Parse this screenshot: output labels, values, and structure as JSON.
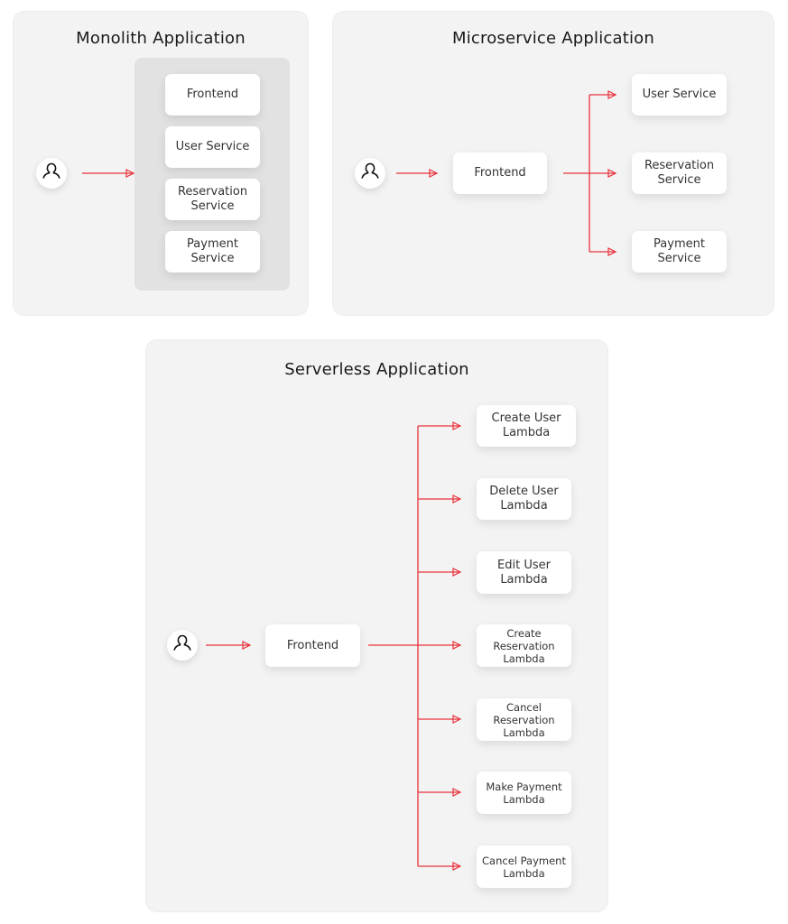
{
  "colors": {
    "arrow": "#e8323c",
    "panel_bg": "#f3f3f3",
    "inner_bg": "#e2e2e2",
    "node_bg": "#ffffff"
  },
  "monolith": {
    "title": "Monolith Application",
    "user_icon": "user-icon",
    "components": [
      "Frontend",
      "User Service",
      "Reservation\nService",
      "Payment\nService"
    ]
  },
  "microservice": {
    "title": "Microservice Application",
    "user_icon": "user-icon",
    "frontend": "Frontend",
    "services": [
      "User Service",
      "Reservation\nService",
      "Payment\nService"
    ]
  },
  "serverless": {
    "title": "Serverless Application",
    "user_icon": "user-icon",
    "frontend": "Frontend",
    "lambdas": [
      "Create User\nLambda",
      "Delete User\nLambda",
      "Edit User\nLambda",
      "Create\nReservation\nLambda",
      "Cancel\nReservation\nLambda",
      "Make Payment\nLambda",
      "Cancel Payment\nLambda"
    ]
  }
}
